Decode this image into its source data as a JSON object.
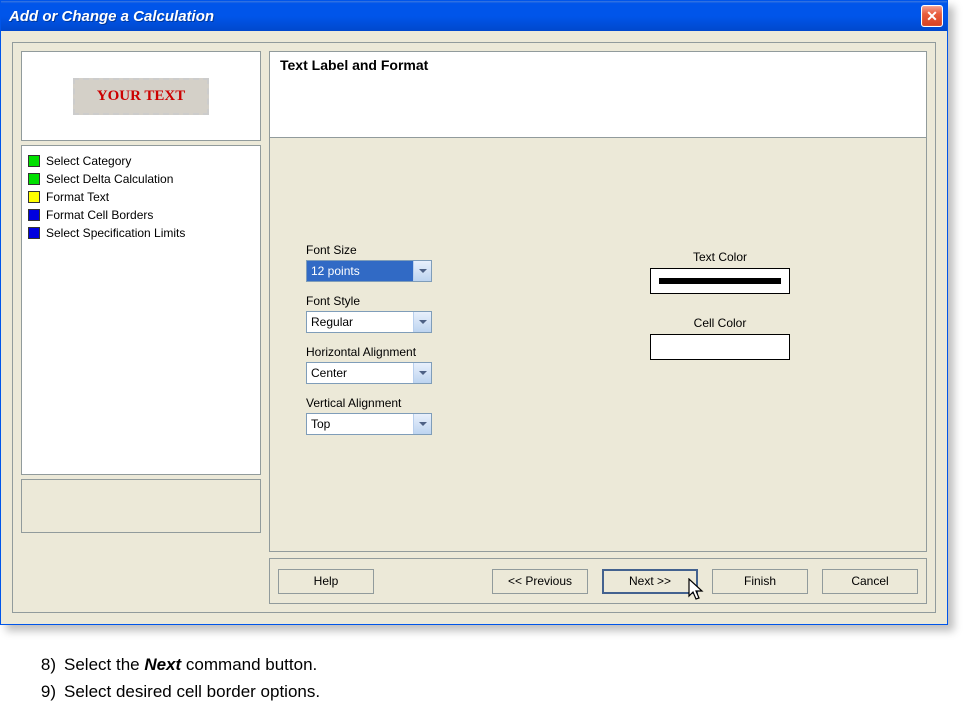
{
  "window": {
    "title": "Add or Change a Calculation"
  },
  "preview": {
    "text": "YOUR TEXT"
  },
  "steps": [
    {
      "label": "Select Category",
      "color": "#00E000"
    },
    {
      "label": "Select Delta Calculation",
      "color": "#00E000"
    },
    {
      "label": "Format Text",
      "color": "#FFFF00"
    },
    {
      "label": "Format Cell Borders",
      "color": "#0000E0"
    },
    {
      "label": "Select Specification Limits",
      "color": "#0000E0"
    }
  ],
  "panel": {
    "title": "Text Label and Format"
  },
  "fields": {
    "fontSize": {
      "label": "Font Size",
      "value": "12 points"
    },
    "fontStyle": {
      "label": "Font Style",
      "value": "Regular"
    },
    "hAlign": {
      "label": "Horizontal Alignment",
      "value": "Center"
    },
    "vAlign": {
      "label": "Vertical Alignment",
      "value": "Top"
    },
    "textColor": {
      "label": "Text Color"
    },
    "cellColor": {
      "label": "Cell Color"
    }
  },
  "buttons": {
    "help": "Help",
    "previous": "<< Previous",
    "next": "Next >>",
    "finish": "Finish",
    "cancel": "Cancel"
  },
  "instructions": {
    "line8num": "8)",
    "line8a": "Select the ",
    "line8b": "Next",
    "line8c": " command button.",
    "line9num": "9)",
    "line9": "Select desired cell border options."
  }
}
